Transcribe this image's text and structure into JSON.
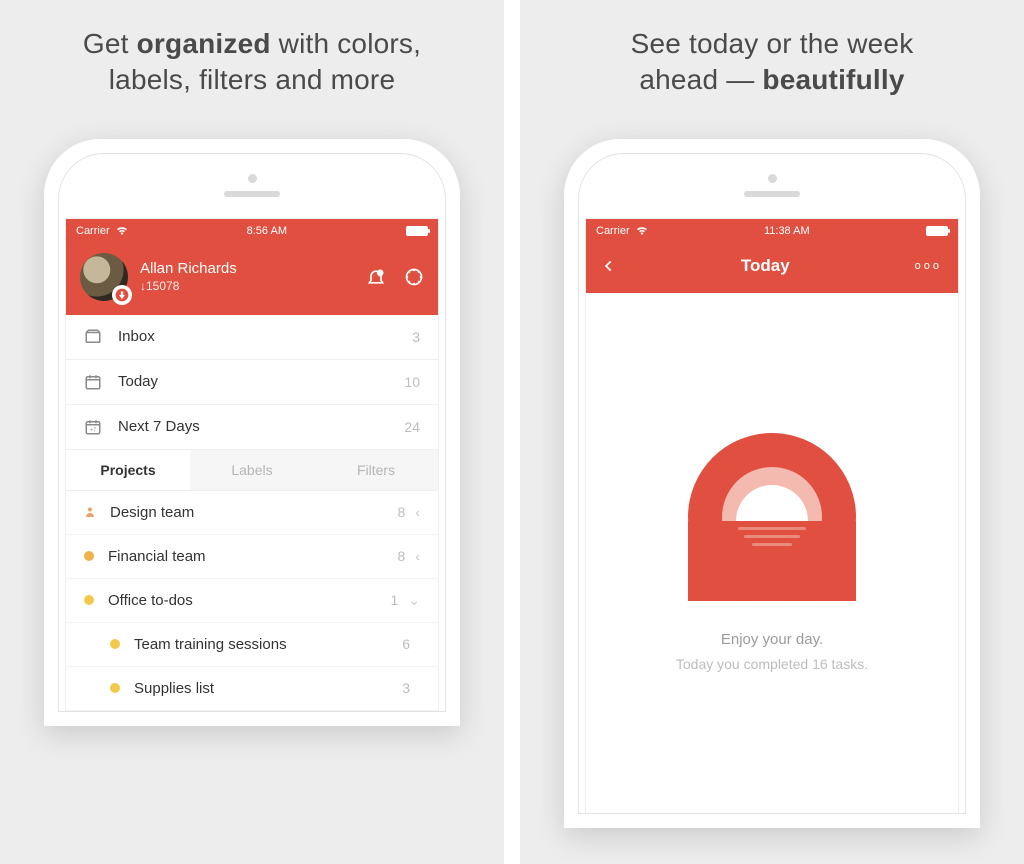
{
  "left": {
    "headline_pre": "Get ",
    "headline_bold": "organized",
    "headline_post": " with colors,\nlabels, filters and more",
    "statusbar": {
      "carrier": "Carrier",
      "time": "8:56 AM"
    },
    "user": {
      "name": "Allan Richards",
      "score": "↓15078"
    },
    "nav": {
      "inbox": {
        "label": "Inbox",
        "count": "3"
      },
      "today": {
        "label": "Today",
        "count": "10"
      },
      "next7": {
        "label": "Next 7 Days",
        "count": "24"
      }
    },
    "tabs": {
      "projects": "Projects",
      "labels": "Labels",
      "filters": "Filters"
    },
    "projects": [
      {
        "label": "Design team",
        "count": "8",
        "chev": "‹",
        "kind": "person"
      },
      {
        "label": "Financial team",
        "count": "8",
        "chev": "‹",
        "kind": "dot",
        "color": "#efb24a"
      },
      {
        "label": "Office to-dos",
        "count": "1",
        "chev": "⌄",
        "kind": "dot",
        "color": "#f2c94c"
      },
      {
        "label": "Team training sessions",
        "count": "6",
        "chev": "",
        "kind": "dot",
        "color": "#f2c94c",
        "sub": true
      },
      {
        "label": "Supplies list",
        "count": "3",
        "chev": "",
        "kind": "dot",
        "color": "#f2c94c",
        "sub": true
      }
    ]
  },
  "right": {
    "headline_pre": "See today or the week\nahead — ",
    "headline_bold": "beautifully",
    "statusbar": {
      "carrier": "Carrier",
      "time": "11:38 AM"
    },
    "title": "Today",
    "more": "ooo",
    "msg1": "Enjoy your day.",
    "msg2": "Today you completed 16 tasks."
  },
  "colors": {
    "accent": "#e04f3f"
  }
}
